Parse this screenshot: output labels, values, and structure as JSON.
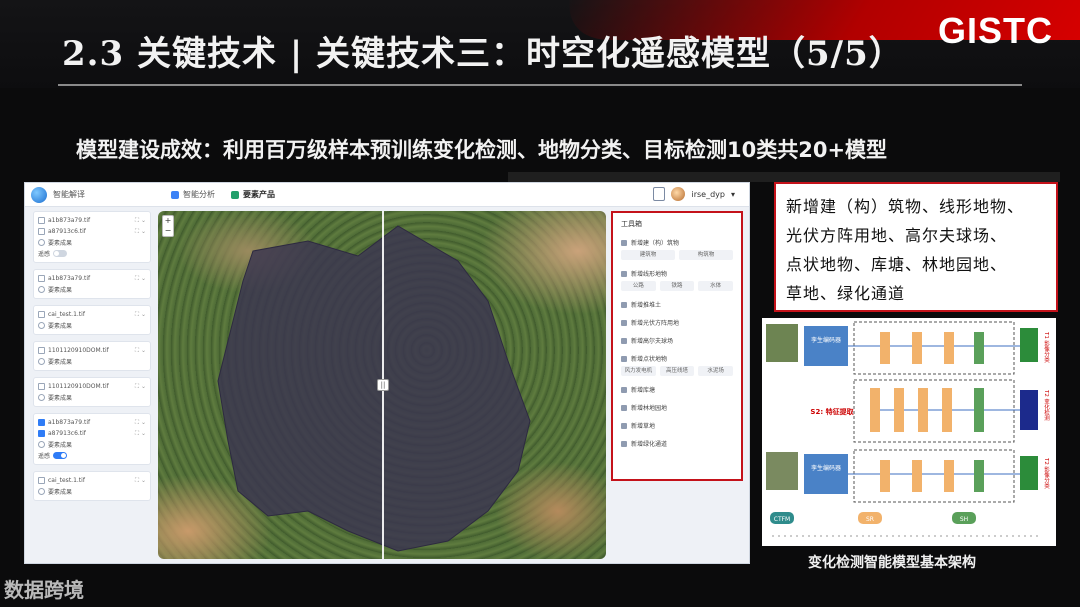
{
  "slide": {
    "title": "2.3 关键技术 | 关键技术三：时空化遥感模型（5/5）",
    "logo_text": "GISTC",
    "subtitle": "模型建设成效：利用百万级样本预训练变化检测、地物分类、目标检测10类共20+模型",
    "watermark": "数据跨境"
  },
  "app": {
    "name": "智能解译",
    "tabs": [
      {
        "label": "智能分析",
        "active": false
      },
      {
        "label": "要素产品",
        "active": true
      }
    ],
    "user": "irse_dyp",
    "layers": [
      {
        "rows": [
          {
            "type": "checkbox",
            "checked": false,
            "label": "a1b873a79.tif"
          },
          {
            "type": "checkbox",
            "checked": false,
            "label": "a87913c6.tif"
          },
          {
            "type": "radio",
            "label": "要素成果"
          },
          {
            "type": "toggle",
            "on": false,
            "label": "遥感"
          }
        ]
      },
      {
        "rows": [
          {
            "type": "checkbox",
            "checked": false,
            "label": "a1b873a79.tif"
          },
          {
            "type": "radio",
            "label": "要素成果"
          }
        ]
      },
      {
        "rows": [
          {
            "type": "checkbox",
            "checked": false,
            "label": "cai_test.1.tif"
          },
          {
            "type": "radio",
            "label": "要素成果"
          }
        ]
      },
      {
        "rows": [
          {
            "type": "checkbox",
            "checked": false,
            "label": "1101120910DOM.tif"
          },
          {
            "type": "radio",
            "label": "要素成果"
          }
        ]
      },
      {
        "rows": [
          {
            "type": "checkbox",
            "checked": false,
            "label": "1101120910DOM.tif"
          },
          {
            "type": "radio",
            "label": "要素成果"
          }
        ]
      },
      {
        "rows": [
          {
            "type": "checkbox",
            "checked": true,
            "label": "a1b873a79.tif"
          },
          {
            "type": "checkbox",
            "checked": true,
            "label": "a87913c6.tif"
          },
          {
            "type": "radio",
            "label": "要素成果"
          },
          {
            "type": "toggle",
            "on": true,
            "label": "遥感"
          }
        ]
      },
      {
        "rows": [
          {
            "type": "checkbox",
            "checked": false,
            "label": "cai_test.1.tif"
          },
          {
            "type": "radio",
            "label": "要素成果"
          }
        ]
      }
    ],
    "toolbox": {
      "title": "工具箱",
      "items": [
        {
          "label": "新增建（构）筑物",
          "buttons": [
            "建筑物",
            "构筑物"
          ]
        },
        {
          "label": "新增线形地物",
          "buttons": [
            "公路",
            "铁路",
            "水体"
          ]
        },
        {
          "label": "新增推堆土",
          "buttons": []
        },
        {
          "label": "新增光伏方阵用地",
          "buttons": []
        },
        {
          "label": "新增高尔夫球场",
          "buttons": []
        },
        {
          "label": "新增点状地物",
          "buttons": [
            "风力发电机",
            "高压线塔",
            "水泥场"
          ]
        },
        {
          "label": "新增库塘",
          "buttons": []
        },
        {
          "label": "新增林地园地",
          "buttons": []
        },
        {
          "label": "新增草地",
          "buttons": []
        },
        {
          "label": "新增绿化通道",
          "buttons": []
        }
      ]
    }
  },
  "callout": {
    "lines": [
      "新增建（构）筑物、线形地物、",
      "光伏方阵用地、高尔夫球场、",
      "点状地物、库塘、林地园地、",
      "草地、绿化通道"
    ]
  },
  "architecture": {
    "caption": "变化检测智能模型基本架构",
    "encoder_label": "孪生编码器",
    "side_labels": [
      "T1 影像分类",
      "T2 变化检测",
      "T2 影像分类"
    ],
    "feature_label": "S2: 特征提取",
    "legend": [
      "CTFM",
      "SR",
      "SH"
    ],
    "colors": {
      "encoder": "#4a82c7",
      "cfm": "#f2b26b",
      "sh": "#5aa05a",
      "arrow": "#3c6fc0"
    }
  }
}
